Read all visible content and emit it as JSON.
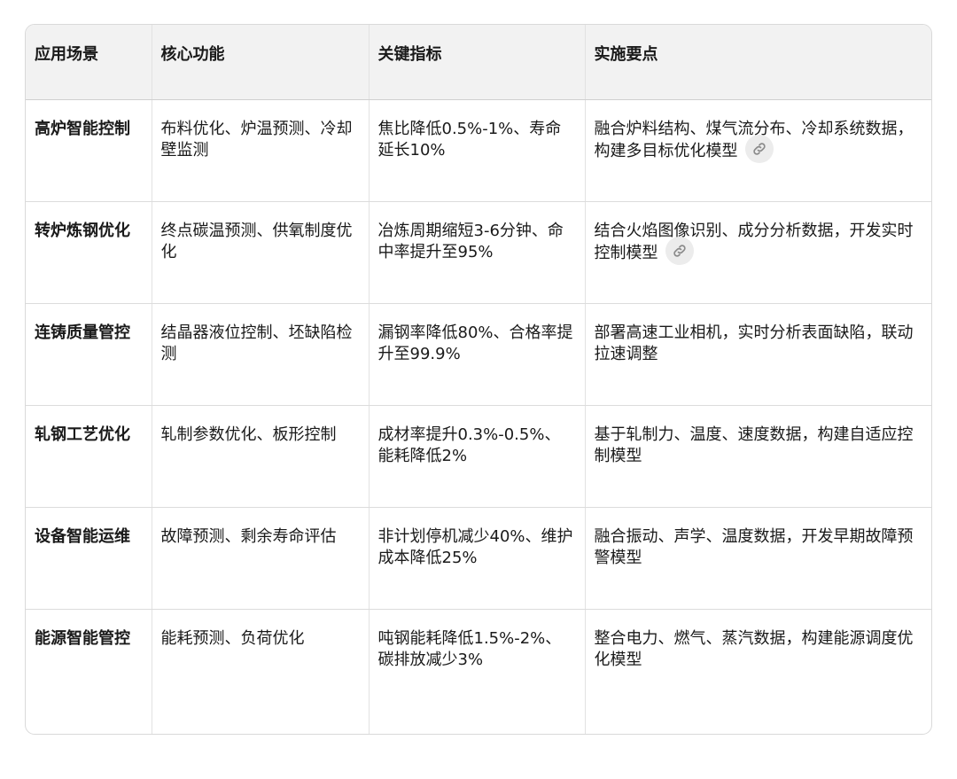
{
  "table": {
    "headers": [
      "应用场景",
      "核心功能",
      "关键指标",
      "实施要点"
    ],
    "rows": [
      {
        "scene": "高炉智能控制",
        "function": "布料优化、炉温预测、冷却壁监测",
        "metric": "焦比降低0.5%-1%、寿命延长10%",
        "point": "融合炉料结构、煤气流分布、冷却系统数据，构建多目标优化模型",
        "has_link": true
      },
      {
        "scene": "转炉炼钢优化",
        "function": "终点碳温预测、供氧制度优化",
        "metric": "冶炼周期缩短3-6分钟、命中率提升至95%",
        "point": "结合火焰图像识别、成分分析数据，开发实时控制模型",
        "has_link": true
      },
      {
        "scene": "连铸质量管控",
        "function": "结晶器液位控制、坯缺陷检测",
        "metric": "漏钢率降低80%、合格率提升至99.9%",
        "point": "部署高速工业相机，实时分析表面缺陷，联动拉速调整",
        "has_link": false
      },
      {
        "scene": "轧钢工艺优化",
        "function": "轧制参数优化、板形控制",
        "metric": "成材率提升0.3%-0.5%、能耗降低2%",
        "point": "基于轧制力、温度、速度数据，构建自适应控制模型",
        "has_link": false
      },
      {
        "scene": "设备智能运维",
        "function": "故障预测、剩余寿命评估",
        "metric": "非计划停机减少40%、维护成本降低25%",
        "point": "融合振动、声学、温度数据，开发早期故障预警模型",
        "has_link": false
      },
      {
        "scene": "能源智能管控",
        "function": "能耗预测、负荷优化",
        "metric": "吨钢能耗降低1.5%-2%、碳排放减少3%",
        "point": "整合电力、燃气、蒸汽数据，构建能源调度优化模型",
        "has_link": false
      }
    ]
  },
  "icons": {
    "source_link": "link-icon"
  }
}
